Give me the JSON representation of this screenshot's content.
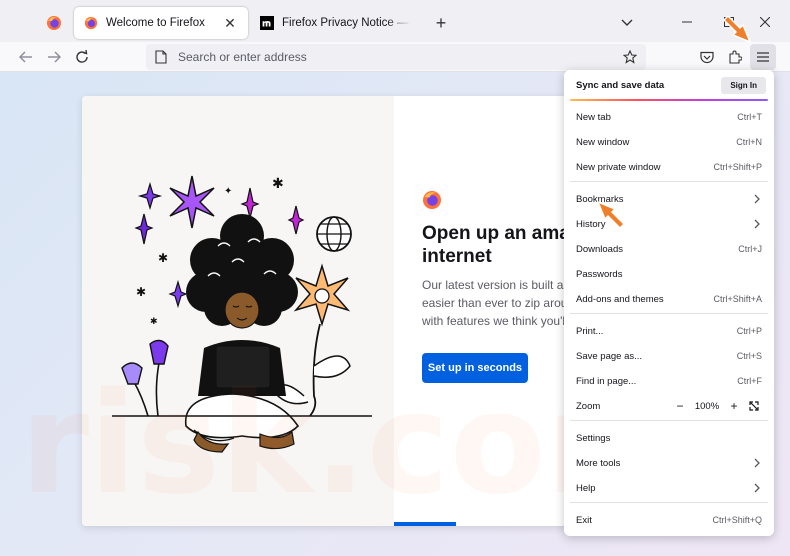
{
  "tabs": {
    "active": {
      "title": "Welcome to Firefox",
      "close": "✕"
    },
    "inactive": {
      "title": "Firefox Privacy Notice — Mozilla"
    },
    "new_tab": "+"
  },
  "navbar": {
    "url_placeholder": "Search or enter address"
  },
  "welcome": {
    "title_line1": "Open up an amazing",
    "title_line2": "internet",
    "subtitle_lines": [
      "Our latest version is built around",
      "easier than ever to zip around the",
      "with features we think you'll love."
    ],
    "cta_label": "Set up in seconds"
  },
  "app_menu": {
    "sync_label": "Sync and save data",
    "sign_in": "Sign In",
    "items": [
      {
        "label": "New tab",
        "shortcut": "Ctrl+T"
      },
      {
        "label": "New window",
        "shortcut": "Ctrl+N"
      },
      {
        "label": "New private window",
        "shortcut": "Ctrl+Shift+P"
      },
      {
        "label": "Bookmarks",
        "shortcut": ""
      },
      {
        "label": "History",
        "shortcut": ""
      },
      {
        "label": "Downloads",
        "shortcut": "Ctrl+J"
      },
      {
        "label": "Passwords",
        "shortcut": ""
      },
      {
        "label": "Add-ons and themes",
        "shortcut": "Ctrl+Shift+A"
      },
      {
        "label": "Print...",
        "shortcut": "Ctrl+P"
      },
      {
        "label": "Save page as...",
        "shortcut": "Ctrl+S"
      },
      {
        "label": "Find in page...",
        "shortcut": "Ctrl+F"
      },
      {
        "label": "Zoom",
        "shortcut": ""
      },
      {
        "label": "Settings",
        "shortcut": ""
      },
      {
        "label": "More tools",
        "shortcut": ""
      },
      {
        "label": "Help",
        "shortcut": ""
      },
      {
        "label": "Exit",
        "shortcut": "Ctrl+Shift+Q"
      }
    ],
    "zoom": {
      "minus": "−",
      "value": "100%",
      "plus": "+"
    }
  },
  "watermark_text": "risk.com",
  "colors": {
    "accent": "#0061e0",
    "pointer": "#f07f2c",
    "page_bg": "#f0f0f4"
  }
}
